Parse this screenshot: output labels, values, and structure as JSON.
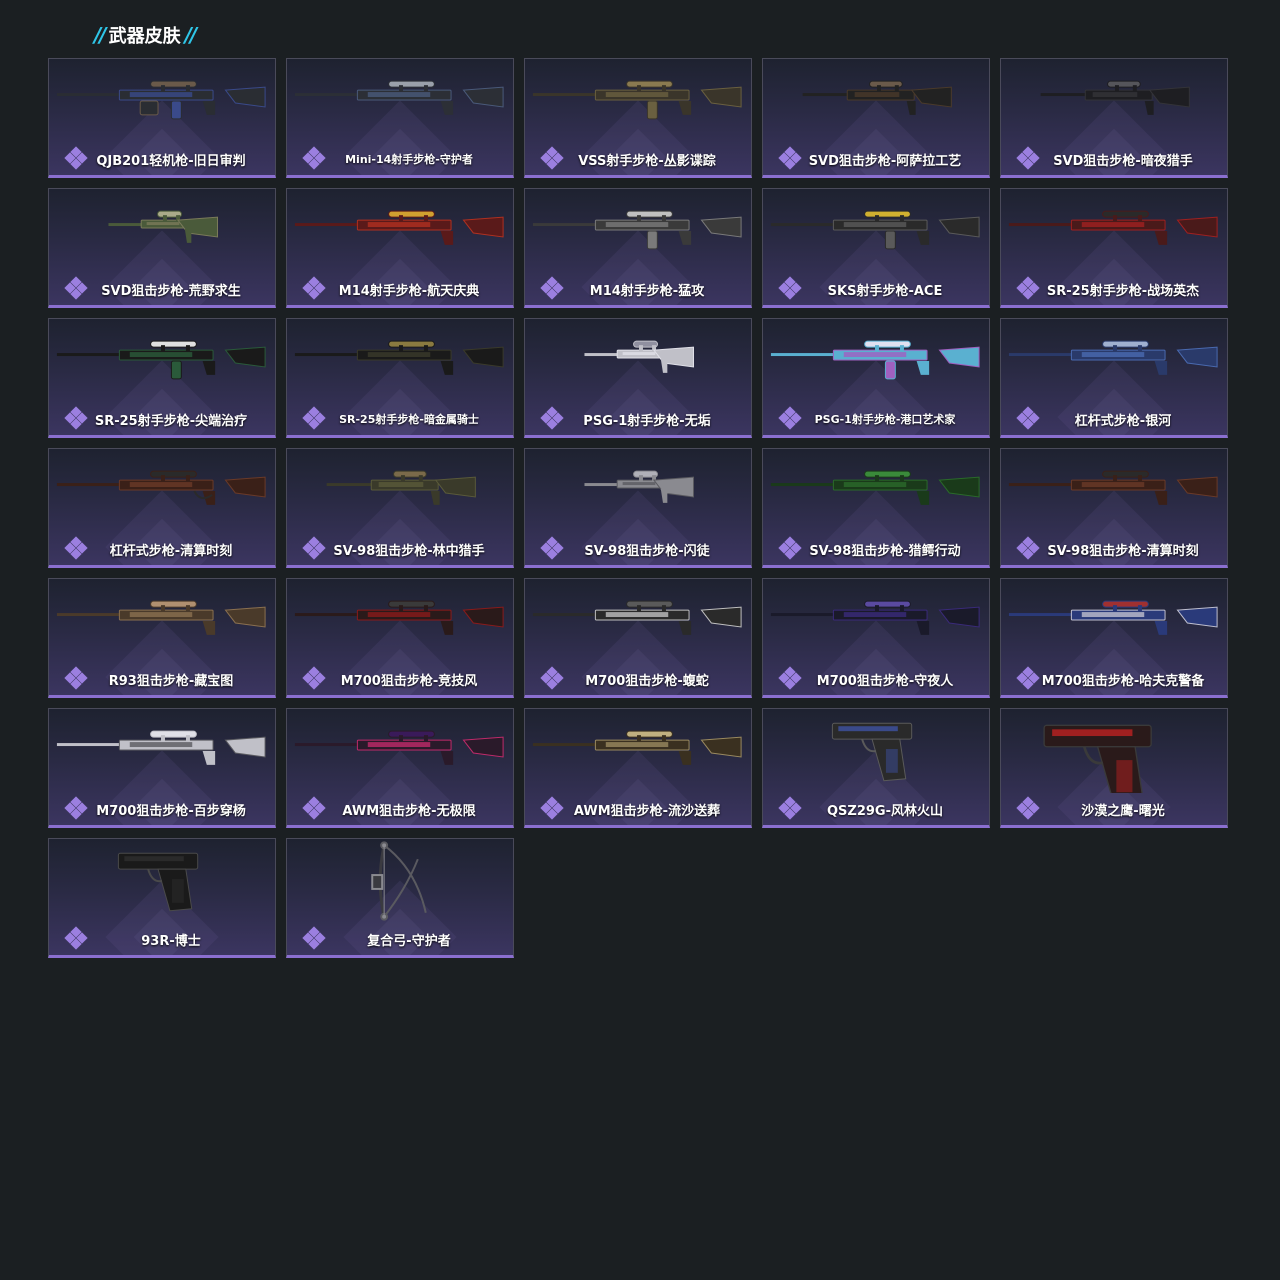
{
  "header": {
    "title": "武器皮肤",
    "accent": "#2fc6e8"
  },
  "rarity_color": "#8b6fd0",
  "items": [
    {
      "name": "QJB201轻机枪-旧日审判",
      "kind": "lmg",
      "colors": [
        "#2a2d33",
        "#3a4a8a",
        "#6a5a4a"
      ]
    },
    {
      "name": "Mini-14射手步枪-守护者",
      "kind": "rifle",
      "colors": [
        "#2c2f36",
        "#4a5a7a",
        "#9aa0aa"
      ]
    },
    {
      "name": "VSS射手步枪-丛影谍踪",
      "kind": "ar",
      "colors": [
        "#3a352a",
        "#6a6040",
        "#8a7a50"
      ]
    },
    {
      "name": "SVD狙击步枪-阿萨拉工艺",
      "kind": "sniper-small",
      "colors": [
        "#222222",
        "#4a3a2a",
        "#6a5a4a"
      ]
    },
    {
      "name": "SVD狙击步枪-暗夜猎手",
      "kind": "sniper-small",
      "colors": [
        "#1e1e22",
        "#333338",
        "#55555a"
      ]
    },
    {
      "name": "SVD狙击步枪-荒野求生",
      "kind": "sniper-tiny",
      "colors": [
        "#4a5a3a",
        "#7a7a5a",
        "#aaaa8a"
      ]
    },
    {
      "name": "M14射手步枪-航天庆典",
      "kind": "rifle",
      "colors": [
        "#5a1a1a",
        "#b03020",
        "#d0a030"
      ]
    },
    {
      "name": "M14射手步枪-猛攻",
      "kind": "ar",
      "colors": [
        "#3a3a3a",
        "#7a7a7a",
        "#c0c0c0"
      ]
    },
    {
      "name": "SKS射手步枪-ACE",
      "kind": "ar",
      "colors": [
        "#2a2a2a",
        "#5a5a5a",
        "#d0b030"
      ]
    },
    {
      "name": "SR-25射手步枪-战场英杰",
      "kind": "rifle",
      "colors": [
        "#4a1a1a",
        "#a02020",
        "#2a2a2a"
      ]
    },
    {
      "name": "SR-25射手步枪-尖端治疗",
      "kind": "ar",
      "colors": [
        "#1a1a1a",
        "#2a5a3a",
        "#e0e0e0"
      ]
    },
    {
      "name": "SR-25射手步枪-暗金属骑士",
      "kind": "rifle",
      "colors": [
        "#1a1a1a",
        "#3a3a2a",
        "#8a7a40"
      ]
    },
    {
      "name": "PSG-1射手步枪-无垢",
      "kind": "sniper-tiny",
      "colors": [
        "#c0c0c8",
        "#e0e0e8",
        "#9090a0"
      ]
    },
    {
      "name": "PSG-1射手步枪-港口艺术家",
      "kind": "ar",
      "colors": [
        "#5ab0d0",
        "#a060c0",
        "#e0e0f0"
      ]
    },
    {
      "name": "杠杆式步枪-银河",
      "kind": "rifle",
      "colors": [
        "#2a3a6a",
        "#4a6ab0",
        "#a0b0d0"
      ]
    },
    {
      "name": "杠杆式步枪-清算时刻",
      "kind": "lever",
      "colors": [
        "#3a2018",
        "#6a3a28",
        "#2a2a2a"
      ]
    },
    {
      "name": "SV-98狙击步枪-林中猎手",
      "kind": "sniper-small",
      "colors": [
        "#3a3a2a",
        "#5a5a3a",
        "#7a6a4a"
      ]
    },
    {
      "name": "SV-98狙击步枪-闪徒",
      "kind": "sniper-tiny",
      "colors": [
        "#8a8a90",
        "#5a5a60",
        "#b0b0b8"
      ]
    },
    {
      "name": "SV-98狙击步枪-猎鳄行动",
      "kind": "sniper",
      "colors": [
        "#1a3a1a",
        "#2a6a2a",
        "#3a8a3a"
      ]
    },
    {
      "name": "SV-98狙击步枪-清算时刻",
      "kind": "sniper",
      "colors": [
        "#3a2018",
        "#6a3a28",
        "#2a2a2a"
      ]
    },
    {
      "name": "R93狙击步枪-藏宝图",
      "kind": "sniper",
      "colors": [
        "#4a3a2a",
        "#8a7050",
        "#b09070"
      ]
    },
    {
      "name": "M700狙击步枪-竞技风",
      "kind": "sniper",
      "colors": [
        "#2a1a1a",
        "#8a1a1a",
        "#3a3a3a"
      ]
    },
    {
      "name": "M700狙击步枪-蝮蛇",
      "kind": "sniper",
      "colors": [
        "#2a2a2a",
        "#c0c0c0",
        "#5a5a5a"
      ]
    },
    {
      "name": "M700狙击步枪-守夜人",
      "kind": "sniper",
      "colors": [
        "#1a1a2a",
        "#3a2a7a",
        "#5a4aa0"
      ]
    },
    {
      "name": "M700狙击步枪-哈夫克警备",
      "kind": "sniper",
      "colors": [
        "#2a3a7a",
        "#c0c0d0",
        "#a03030"
      ]
    },
    {
      "name": "M700狙击步枪-百步穿杨",
      "kind": "sniper",
      "colors": [
        "#c0c0c8",
        "#5a5a60",
        "#e0e0e8"
      ]
    },
    {
      "name": "AWM狙击步枪-无极限",
      "kind": "sniper",
      "colors": [
        "#2a1a2a",
        "#c02a6a",
        "#3a1a5a"
      ]
    },
    {
      "name": "AWM狙击步枪-流沙送葬",
      "kind": "sniper",
      "colors": [
        "#3a3020",
        "#9a8a60",
        "#c0b080"
      ]
    },
    {
      "name": "QSZ29G-风林火山",
      "kind": "pistol",
      "colors": [
        "#2a2a2a",
        "#3a4a8a",
        "#5a5a5a"
      ]
    },
    {
      "name": "沙漠之鹰-曙光",
      "kind": "pistol-big",
      "colors": [
        "#2a1a1a",
        "#a02020",
        "#3a3a3a"
      ]
    },
    {
      "name": "93R-博士",
      "kind": "pistol",
      "colors": [
        "#1a1a1a",
        "#2a2a2a",
        "#4a4a4a"
      ]
    },
    {
      "name": "复合弓-守护者",
      "kind": "bow",
      "colors": [
        "#3a3a40",
        "#5a5a60",
        "#8a8a90"
      ]
    }
  ]
}
